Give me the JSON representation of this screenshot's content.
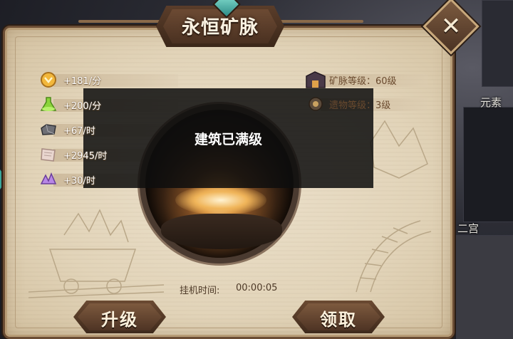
{
  "window": {
    "title": "永恒矿脉",
    "close_icon": "close-x-icon"
  },
  "background": {
    "labels": [
      "元素",
      "二宫"
    ]
  },
  "resources": [
    {
      "icon": "gold-coin-icon",
      "text": "+181/分"
    },
    {
      "icon": "green-potion-icon",
      "text": "+200/分"
    },
    {
      "icon": "iron-ore-icon",
      "text": "+67/时"
    },
    {
      "icon": "scroll-icon",
      "text": "+2945/时"
    },
    {
      "icon": "purple-crystal-icon",
      "text": "+30/时"
    }
  ],
  "info": [
    {
      "icon": "mine-building-icon",
      "text": "矿脉等级：60级"
    },
    {
      "icon": "relic-icon",
      "text": "遗物等级：3级"
    }
  ],
  "toast": {
    "message": "建筑已满级"
  },
  "idle": {
    "label": "挂机时间:",
    "value": "00:00:05"
  },
  "buttons": {
    "upgrade_label": "升级",
    "collect_label": "领取"
  },
  "colors": {
    "panel_parchment": "#e2d4b9",
    "frame_brown": "#6b4d34",
    "accent_teal": "#4fc4b6"
  }
}
